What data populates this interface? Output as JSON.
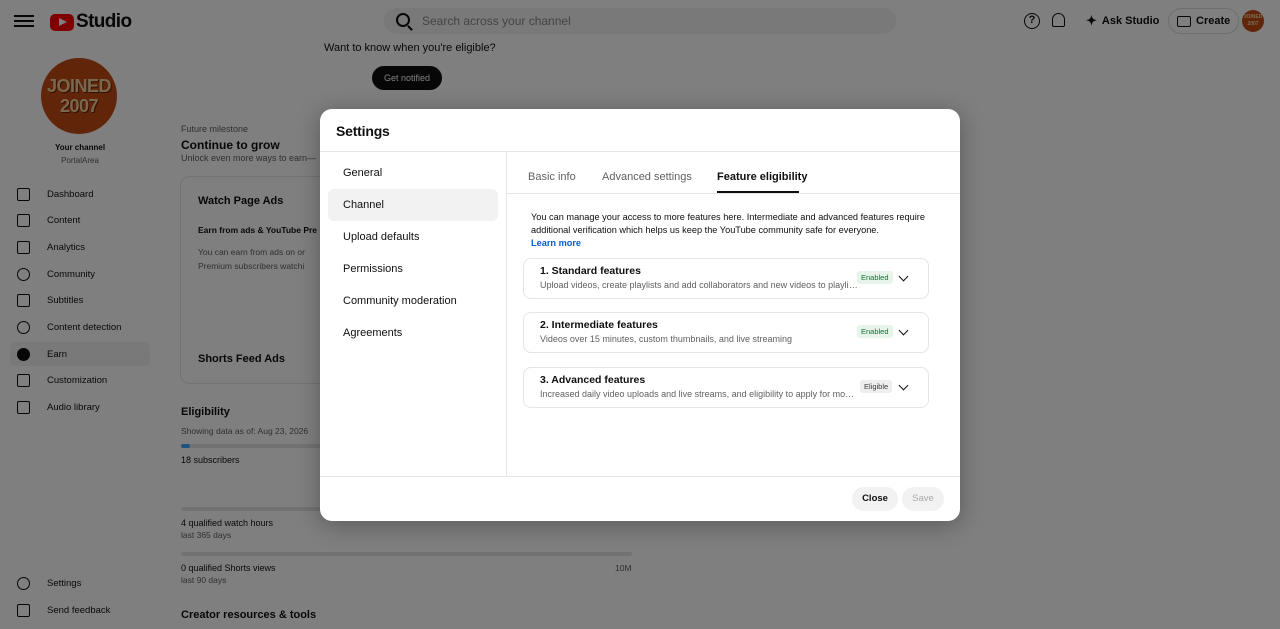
{
  "header": {
    "logo_text": "Studio",
    "search_placeholder": "Search across your channel",
    "ask_label": "Ask Studio",
    "create_label": "Create"
  },
  "sidebar": {
    "avatar_text_1": "JOINED",
    "avatar_text_2": "2007",
    "your_channel": "Your channel",
    "channel_name": "PortalArea",
    "items": [
      {
        "label": "Dashboard",
        "icon": "dashboard-icon"
      },
      {
        "label": "Content",
        "icon": "content-icon"
      },
      {
        "label": "Analytics",
        "icon": "analytics-icon"
      },
      {
        "label": "Community",
        "icon": "community-icon"
      },
      {
        "label": "Subtitles",
        "icon": "subtitles-icon"
      },
      {
        "label": "Content detection",
        "icon": "copyright-icon"
      },
      {
        "label": "Earn",
        "icon": "earn-icon"
      },
      {
        "label": "Customization",
        "icon": "customization-icon"
      },
      {
        "label": "Audio library",
        "icon": "audio-library-icon"
      }
    ],
    "bottom_items": [
      {
        "label": "Settings",
        "icon": "gear-icon"
      },
      {
        "label": "Send feedback",
        "icon": "feedback-icon"
      }
    ]
  },
  "background": {
    "eligible_question": "Want to know when you're eligible?",
    "get_notified": "Get notified",
    "future_milestone": "Future milestone",
    "continue_to_grow": "Continue to grow",
    "unlock_text": "Unlock even more ways to earn—",
    "watch_page_ads": "Watch Page Ads",
    "earn_from_ads": "Earn from ads & YouTube Pre",
    "earn_desc_1": "You can earn from ads on or",
    "earn_desc_2": "Premium subscribers watchi",
    "shorts_feed_ads": "Shorts Feed Ads",
    "eligibility": "Eligibility",
    "showing_data": "Showing data as of: Aug 23, 2026",
    "subscribers": "18 subscribers",
    "watch_hours": "4 qualified watch hours",
    "last_365": "last 365 days",
    "shorts_views": "0 qualified Shorts views",
    "last_90": "last 90 days",
    "ten_m": "10M",
    "creator_resources": "Creator resources & tools"
  },
  "modal": {
    "title": "Settings",
    "side_items": [
      "General",
      "Channel",
      "Upload defaults",
      "Permissions",
      "Community moderation",
      "Agreements"
    ],
    "active_side_item": "Channel",
    "tabs": [
      "Basic info",
      "Advanced settings",
      "Feature eligibility"
    ],
    "active_tab": "Feature eligibility",
    "intro": "You can manage your access to more features here. Intermediate and advanced features require additional verification which helps us keep the YouTube community safe for everyone.",
    "learn_more": "Learn more",
    "features": [
      {
        "title": "1. Standard features",
        "desc": "Upload videos, create playlists and add collaborators and new videos to playlists",
        "status": "Enabled"
      },
      {
        "title": "2. Intermediate features",
        "desc": "Videos over 15 minutes, custom thumbnails, and live streaming",
        "status": "Enabled"
      },
      {
        "title": "3. Advanced features",
        "desc": "Increased daily video uploads and live streams, and eligibility to apply for monetization",
        "status": "Eligible"
      }
    ],
    "close_label": "Close",
    "save_label": "Save"
  },
  "colors": {
    "brand_red": "#ff0000",
    "link_blue": "#065fd4",
    "enabled_green_bg": "#e6f4ea",
    "enabled_green_text": "#137333"
  }
}
